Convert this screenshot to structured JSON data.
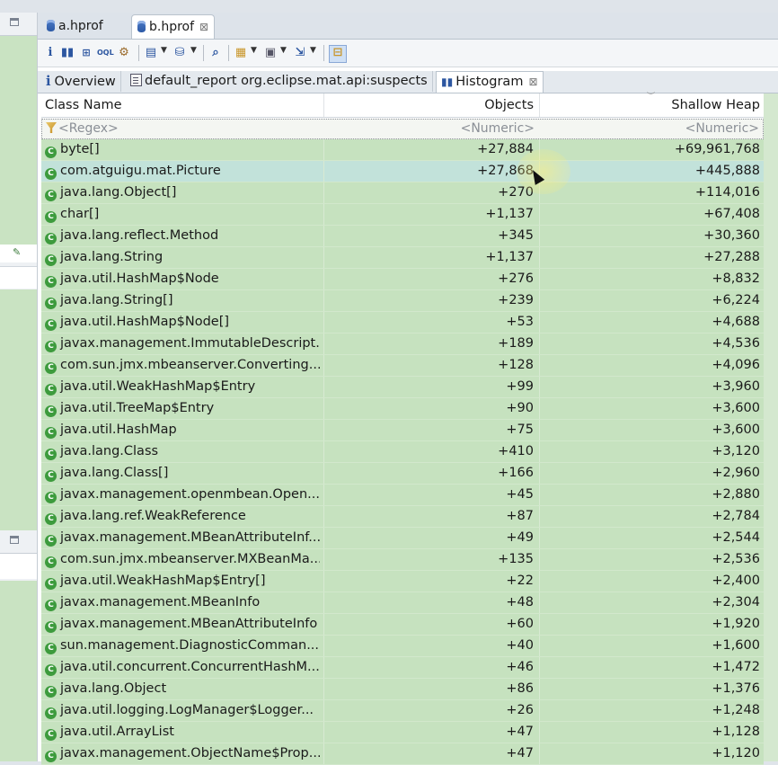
{
  "editor_tabs": [
    {
      "label": "a.hprof",
      "active": false
    },
    {
      "label": "b.hprof",
      "active": true,
      "close": "⊠"
    }
  ],
  "toolbar": {
    "icons": [
      "info-icon",
      "histogram-icon",
      "dominator-tree-icon",
      "oql-icon",
      "heapdump-overview-icon",
      "query-browser-icon",
      "find-object-icon",
      "search-icon",
      "group-by-icon",
      "calculate-retained-icon",
      "export-icon",
      "pin-icon"
    ]
  },
  "sub_tabs": {
    "overview": "Overview",
    "report": "default_report  org.eclipse.mat.api:suspects",
    "histogram": "Histogram",
    "histogram_close": "⊠"
  },
  "table": {
    "headers": {
      "class_name": "Class Name",
      "objects": "Objects",
      "shallow_heap": "Shallow Heap"
    },
    "filters": {
      "class_name": "<Regex>",
      "objects": "<Numeric>",
      "shallow_heap": "<Numeric>"
    },
    "rows": [
      {
        "name": "byte[]",
        "objects": "+27,884",
        "shallow": "+69,961,768"
      },
      {
        "name": "com.atguigu.mat.Picture",
        "objects": "+27,868",
        "shallow": "+445,888"
      },
      {
        "name": "java.lang.Object[]",
        "objects": "+270",
        "shallow": "+114,016"
      },
      {
        "name": "char[]",
        "objects": "+1,137",
        "shallow": "+67,408"
      },
      {
        "name": "java.lang.reflect.Method",
        "objects": "+345",
        "shallow": "+30,360"
      },
      {
        "name": "java.lang.String",
        "objects": "+1,137",
        "shallow": "+27,288"
      },
      {
        "name": "java.util.HashMap$Node",
        "objects": "+276",
        "shallow": "+8,832"
      },
      {
        "name": "java.lang.String[]",
        "objects": "+239",
        "shallow": "+6,224"
      },
      {
        "name": "java.util.HashMap$Node[]",
        "objects": "+53",
        "shallow": "+4,688"
      },
      {
        "name": "javax.management.ImmutableDescript...",
        "objects": "+189",
        "shallow": "+4,536"
      },
      {
        "name": "com.sun.jmx.mbeanserver.Converting...",
        "objects": "+128",
        "shallow": "+4,096"
      },
      {
        "name": "java.util.WeakHashMap$Entry",
        "objects": "+99",
        "shallow": "+3,960"
      },
      {
        "name": "java.util.TreeMap$Entry",
        "objects": "+90",
        "shallow": "+3,600"
      },
      {
        "name": "java.util.HashMap",
        "objects": "+75",
        "shallow": "+3,600"
      },
      {
        "name": "java.lang.Class",
        "objects": "+410",
        "shallow": "+3,120"
      },
      {
        "name": "java.lang.Class[]",
        "objects": "+166",
        "shallow": "+2,960"
      },
      {
        "name": "javax.management.openmbean.Open...",
        "objects": "+45",
        "shallow": "+2,880"
      },
      {
        "name": "java.lang.ref.WeakReference",
        "objects": "+87",
        "shallow": "+2,784"
      },
      {
        "name": "javax.management.MBeanAttributeInf...",
        "objects": "+49",
        "shallow": "+2,544"
      },
      {
        "name": "com.sun.jmx.mbeanserver.MXBeanMa...",
        "objects": "+135",
        "shallow": "+2,536"
      },
      {
        "name": "java.util.WeakHashMap$Entry[]",
        "objects": "+22",
        "shallow": "+2,400"
      },
      {
        "name": "javax.management.MBeanInfo",
        "objects": "+48",
        "shallow": "+2,304"
      },
      {
        "name": "javax.management.MBeanAttributeInfo",
        "objects": "+60",
        "shallow": "+1,920"
      },
      {
        "name": "sun.management.DiagnosticComman...",
        "objects": "+40",
        "shallow": "+1,600"
      },
      {
        "name": "java.util.concurrent.ConcurrentHashM...",
        "objects": "+46",
        "shallow": "+1,472"
      },
      {
        "name": "java.lang.Object",
        "objects": "+86",
        "shallow": "+1,376"
      },
      {
        "name": "java.util.logging.LogManager$Logger...",
        "objects": "+26",
        "shallow": "+1,248"
      },
      {
        "name": "java.util.ArrayList",
        "objects": "+47",
        "shallow": "+1,128"
      },
      {
        "name": "javax.management.ObjectName$Prop...",
        "objects": "+47",
        "shallow": "+1,120"
      }
    ],
    "selected_row": 1
  },
  "colors": {
    "row_bg": "#c6e2bf",
    "selected_row_bg": "#c2e2da",
    "accent": "#2c56a0",
    "class_icon": "#3d9b3d"
  }
}
